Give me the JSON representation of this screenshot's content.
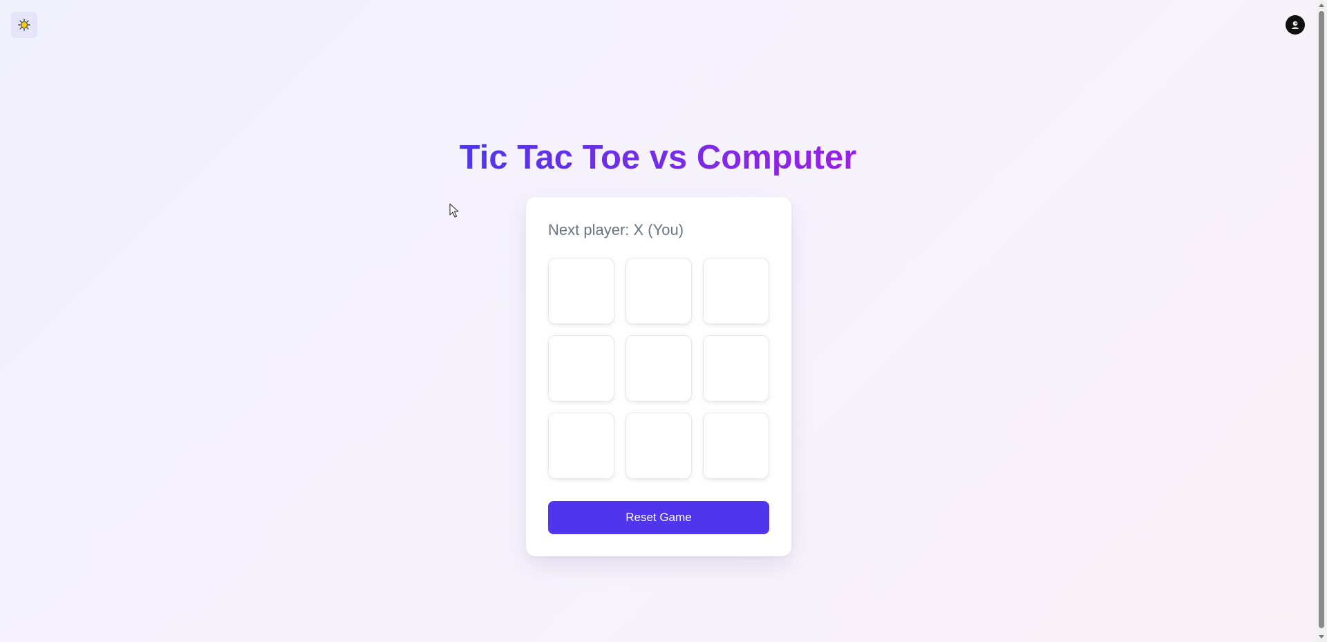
{
  "header": {
    "theme_toggle_icon": "sun-icon",
    "avatar_icon": "user-avatar-icon"
  },
  "game": {
    "title": "Tic Tac Toe vs Computer",
    "status": "Next player: X (You)",
    "board": [
      [
        "",
        "",
        ""
      ],
      [
        "",
        "",
        ""
      ],
      [
        "",
        "",
        ""
      ]
    ],
    "reset_label": "Reset Game"
  },
  "colors": {
    "accent": "#4f35ec",
    "title_gradient_start": "#4f36e8",
    "title_gradient_end": "#9b1fe6",
    "status_text": "#6b7280",
    "sun_icon": "#f5c518"
  }
}
